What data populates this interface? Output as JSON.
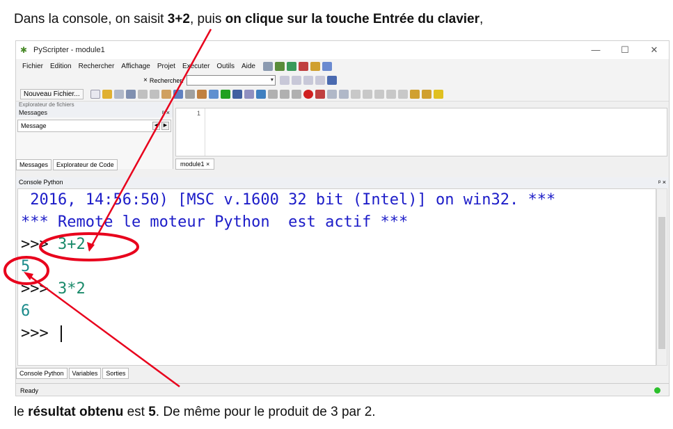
{
  "caption_top": {
    "t1": "Dans la console, on saisit ",
    "b1": "3+2",
    "t2": ", puis ",
    "b2": "on clique sur la touche Entrée du clavier",
    "t3": ","
  },
  "caption_bottom": {
    "t1": "le ",
    "b1": "résultat obtenu",
    "t2": " est ",
    "b2": "5",
    "t3": ". De même pour le produit de 3 par 2."
  },
  "window": {
    "title": "PyScripter - module1",
    "controls": [
      "—",
      "☐",
      "✕"
    ]
  },
  "menu": [
    "Fichier",
    "Edition",
    "Rechercher",
    "Affichage",
    "Projet",
    "Exécuter",
    "Outils",
    "Aide"
  ],
  "search": {
    "close": "×",
    "label": "Rechercher:",
    "value": ""
  },
  "toolbar": {
    "new_file": "Nouveau Fichier..."
  },
  "left_pane": {
    "header_top": "Explorateur de fichiers",
    "header": "Messages",
    "pin": "ᵖ ×",
    "box_label": "Message",
    "tabs": [
      "Messages",
      "Explorateur de Code"
    ]
  },
  "editor": {
    "line": "1",
    "tab": "module1  ×"
  },
  "console": {
    "title": "Console Python",
    "pin": "ᵖ ×",
    "lines": [
      {
        "kind": "blue",
        "text": " 2016, 14:56:50) [MSC v.1600 32 bit (Intel)] on win32. ***"
      },
      {
        "kind": "blue",
        "text": "*** Remote le moteur Python  est actif ***"
      },
      {
        "kind": "input",
        "prompt": ">>> ",
        "text": "3+2"
      },
      {
        "kind": "result",
        "text": "5"
      },
      {
        "kind": "input",
        "prompt": ">>> ",
        "text": "3*2"
      },
      {
        "kind": "result",
        "text": "6"
      },
      {
        "kind": "cursor",
        "prompt": ">>> "
      }
    ]
  },
  "bottom_tabs": [
    "Console Python",
    "Variables",
    "Sorties"
  ],
  "status": {
    "text": "Ready"
  },
  "annotation_color": "#e8001c"
}
